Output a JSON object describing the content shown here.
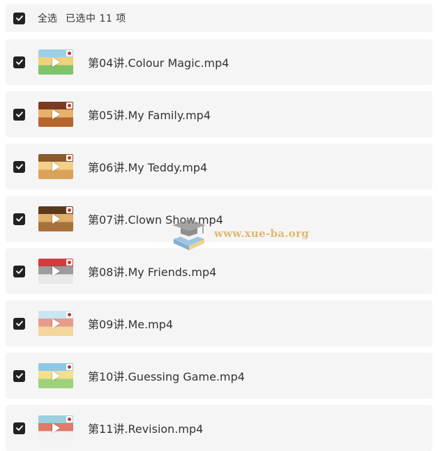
{
  "header": {
    "select_all_label": "全选",
    "selected_count": "已选中  11  项",
    "checked": true
  },
  "items": [
    {
      "filename": "第04讲.Colour Magic.mp4",
      "checked": true,
      "thumb_colors": [
        "#7fc36b",
        "#f0d27a",
        "#9ad1e8"
      ]
    },
    {
      "filename": "第05讲.My Family.mp4",
      "checked": true,
      "thumb_colors": [
        "#b5652e",
        "#e8b26a",
        "#7a3b1f"
      ]
    },
    {
      "filename": "第06讲.My Teddy.mp4",
      "checked": true,
      "thumb_colors": [
        "#d9a35a",
        "#f3d08a",
        "#8a5a2b"
      ]
    },
    {
      "filename": "第07讲.Clown Show.mp4",
      "checked": true,
      "thumb_colors": [
        "#a8713c",
        "#e0b06a",
        "#5b3a1c"
      ]
    },
    {
      "filename": "第08讲.My Friends.mp4",
      "checked": true,
      "thumb_colors": [
        "#e9e9e9",
        "#9c9c9c",
        "#d23b3b"
      ]
    },
    {
      "filename": "第09讲.Me.mp4",
      "checked": true,
      "thumb_colors": [
        "#f4d59b",
        "#e89b8c",
        "#c9e6f2"
      ]
    },
    {
      "filename": "第10讲.Guessing Game.mp4",
      "checked": true,
      "thumb_colors": [
        "#9ed27a",
        "#f2e08c",
        "#8cc9e8"
      ]
    },
    {
      "filename": "第11讲.Revision.mp4",
      "checked": true,
      "thumb_colors": [
        "#f2f2f2",
        "#e07a6a",
        "#9ad0e0"
      ]
    }
  ],
  "watermark": {
    "text": "www.xue-ba.org",
    "logo": "graduation-cap-books-logo"
  },
  "icons": {
    "checkbox": "checkbox-checked-icon",
    "play": "play-icon"
  },
  "colors": {
    "row_bg": "#f5f5f5",
    "checkbox": "#222222",
    "text": "#333333",
    "watermark": "#d9a441"
  }
}
